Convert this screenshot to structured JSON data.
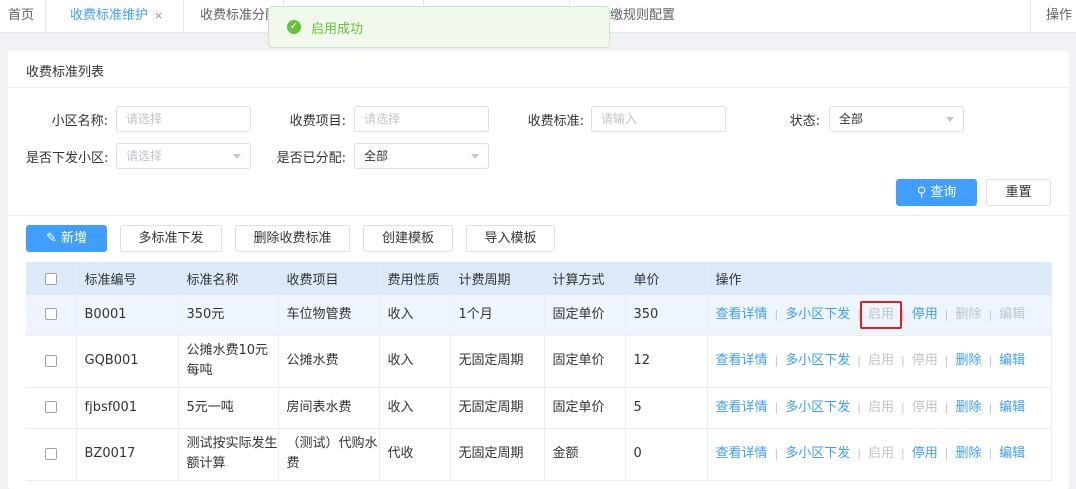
{
  "tabs": [
    {
      "label": "首页",
      "active": false
    },
    {
      "label": "收费标准维护",
      "active": true
    },
    {
      "label": "收费标准分配",
      "active": false
    },
    {
      "label": "",
      "active": false
    },
    {
      "label": "",
      "active": false
    },
    {
      "label": "缴规则配置",
      "active": false
    }
  ],
  "tab_close": "×",
  "tab_ops": "操作",
  "toast": {
    "icon": "✓",
    "message": "启用成功",
    "color": "#67c23a"
  },
  "card_title": "收费标准列表",
  "filters": {
    "community_label": "小区名称:",
    "community_placeholder": "请选择",
    "item_label": "收费项目:",
    "item_placeholder": "请选择",
    "standard_label": "收费标准:",
    "standard_placeholder": "请输入",
    "status_label": "状态:",
    "status_value": "全部",
    "dispatched_label": "是否下发小区:",
    "dispatched_placeholder": "请选择",
    "assigned_label": "是否已分配:",
    "assigned_value": "全部"
  },
  "buttons": {
    "query": "查询",
    "reset": "重置",
    "add": "新增",
    "multi_dispatch": "多标准下发",
    "delete_standard": "删除收费标准",
    "create_template": "创建模板",
    "import_template": "导入模板"
  },
  "table": {
    "headers": [
      "标准编号",
      "标准名称",
      "收费项目",
      "费用性质",
      "计费周期",
      "计算方式",
      "单价",
      "操作"
    ],
    "rows": [
      {
        "code": "B0001",
        "name": "350元",
        "item": "车位物管费",
        "nature": "收入",
        "period": "1个月",
        "method": "固定单价",
        "price": "350"
      },
      {
        "code": "GQB001",
        "name": "公摊水费10元每吨",
        "item": "公摊水费",
        "nature": "收入",
        "period": "无固定周期",
        "method": "固定单价",
        "price": "12"
      },
      {
        "code": "fjbsf001",
        "name": "5元一吨",
        "item": "房间表水费",
        "nature": "收入",
        "period": "无固定周期",
        "method": "固定单价",
        "price": "5"
      },
      {
        "code": "BZ0017",
        "name": "测试按实际发生额计算",
        "item": "（测试）代购水费",
        "nature": "代收",
        "period": "无固定周期",
        "method": "金额",
        "price": "0"
      }
    ],
    "ops": {
      "detail": "查看详情",
      "multi": "多小区下发",
      "enable": "启用",
      "disable": "停用",
      "delete": "删除",
      "edit": "编辑"
    }
  },
  "colors": {
    "primary": "#409eff",
    "disabled": "#c0c4cc",
    "header_bg": "#dce9f8",
    "highlight_box": "#e02020"
  }
}
